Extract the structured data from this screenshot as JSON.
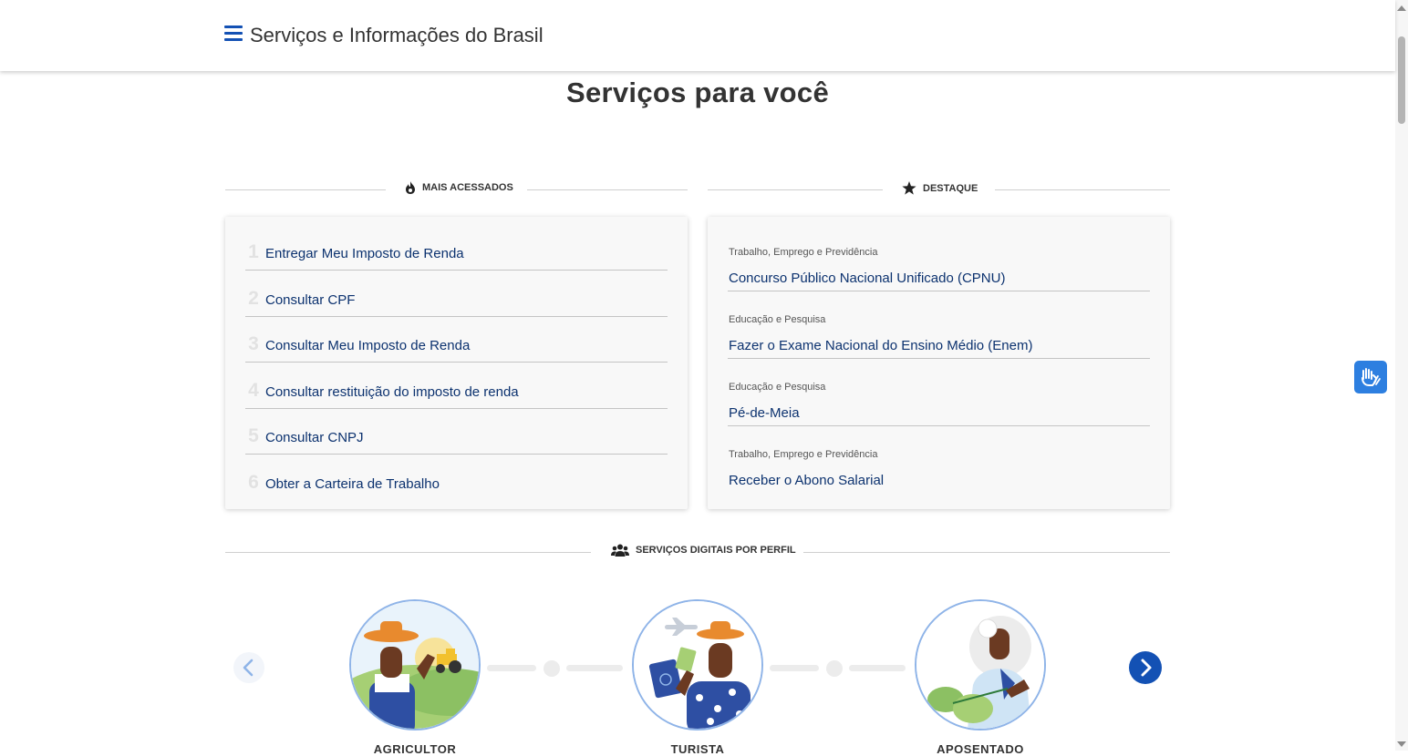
{
  "header": {
    "site_title": "Serviços e Informações do Brasil",
    "menu_icon": "hamburger-menu-icon"
  },
  "main": {
    "page_title": "Serviços para você"
  },
  "most_accessed": {
    "heading": "MAIS ACESSADOS",
    "icon": "flame-icon",
    "items": [
      {
        "num": "1",
        "label": "Entregar Meu Imposto de Renda"
      },
      {
        "num": "2",
        "label": "Consultar CPF"
      },
      {
        "num": "3",
        "label": "Consultar Meu Imposto de Renda"
      },
      {
        "num": "4",
        "label": "Consultar restituição do imposto de renda"
      },
      {
        "num": "5",
        "label": "Consultar CNPJ"
      },
      {
        "num": "6",
        "label": "Obter a Carteira de Trabalho"
      }
    ]
  },
  "highlights": {
    "heading": "DESTAQUE",
    "icon": "star-icon",
    "items": [
      {
        "category": "Trabalho, Emprego e Previdência",
        "title": "Concurso Público Nacional Unificado (CPNU)"
      },
      {
        "category": "Educação e Pesquisa",
        "title": "Fazer o Exame Nacional do Ensino Médio (Enem)"
      },
      {
        "category": "Educação e Pesquisa",
        "title": "Pé-de-Meia"
      },
      {
        "category": "Trabalho, Emprego e Previdência",
        "title": "Receber o Abono Salarial"
      }
    ]
  },
  "profiles": {
    "heading": "SERVIÇOS DIGITAIS POR PERFIL",
    "icon": "users-icon",
    "items": [
      {
        "label": "AGRICULTOR"
      },
      {
        "label": "TURISTA"
      },
      {
        "label": "APOSENTADO"
      }
    ]
  },
  "colors": {
    "primary": "#1351b4",
    "link": "#0c326f",
    "vlibras": "#2d7fe0"
  }
}
